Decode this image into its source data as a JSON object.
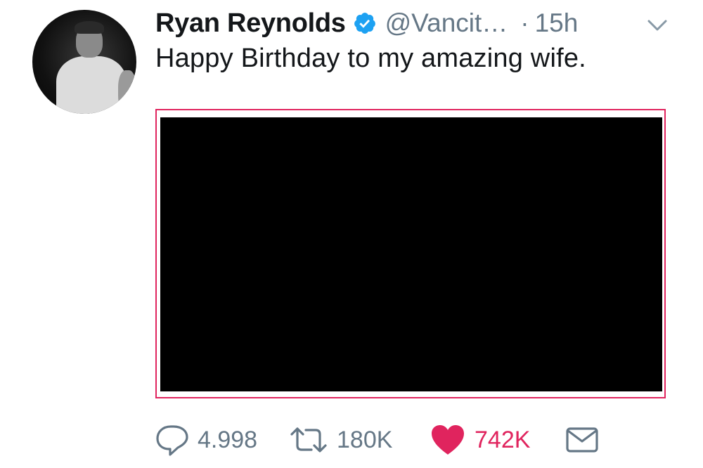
{
  "tweet": {
    "author_name": "Ryan Reynolds",
    "handle": "@Vancit…",
    "separator": "·",
    "timestamp": "15h",
    "text": "Happy Birthday to my amazing wife.",
    "verified": true,
    "avatar": "profile-photo-icon",
    "media": "black-photo"
  },
  "actions": {
    "reply": {
      "icon": "reply-icon",
      "count": "4.998"
    },
    "retweet": {
      "icon": "retweet-icon",
      "count": "180K"
    },
    "like": {
      "icon": "heart-icon",
      "count": "742K",
      "liked": true
    },
    "dm": {
      "icon": "envelope-icon"
    }
  },
  "colors": {
    "text": "#14171a",
    "secondary": "#657786",
    "verified_blue": "#1da1f2",
    "like_pink": "#e0245e",
    "media_border": "#e0245e"
  }
}
